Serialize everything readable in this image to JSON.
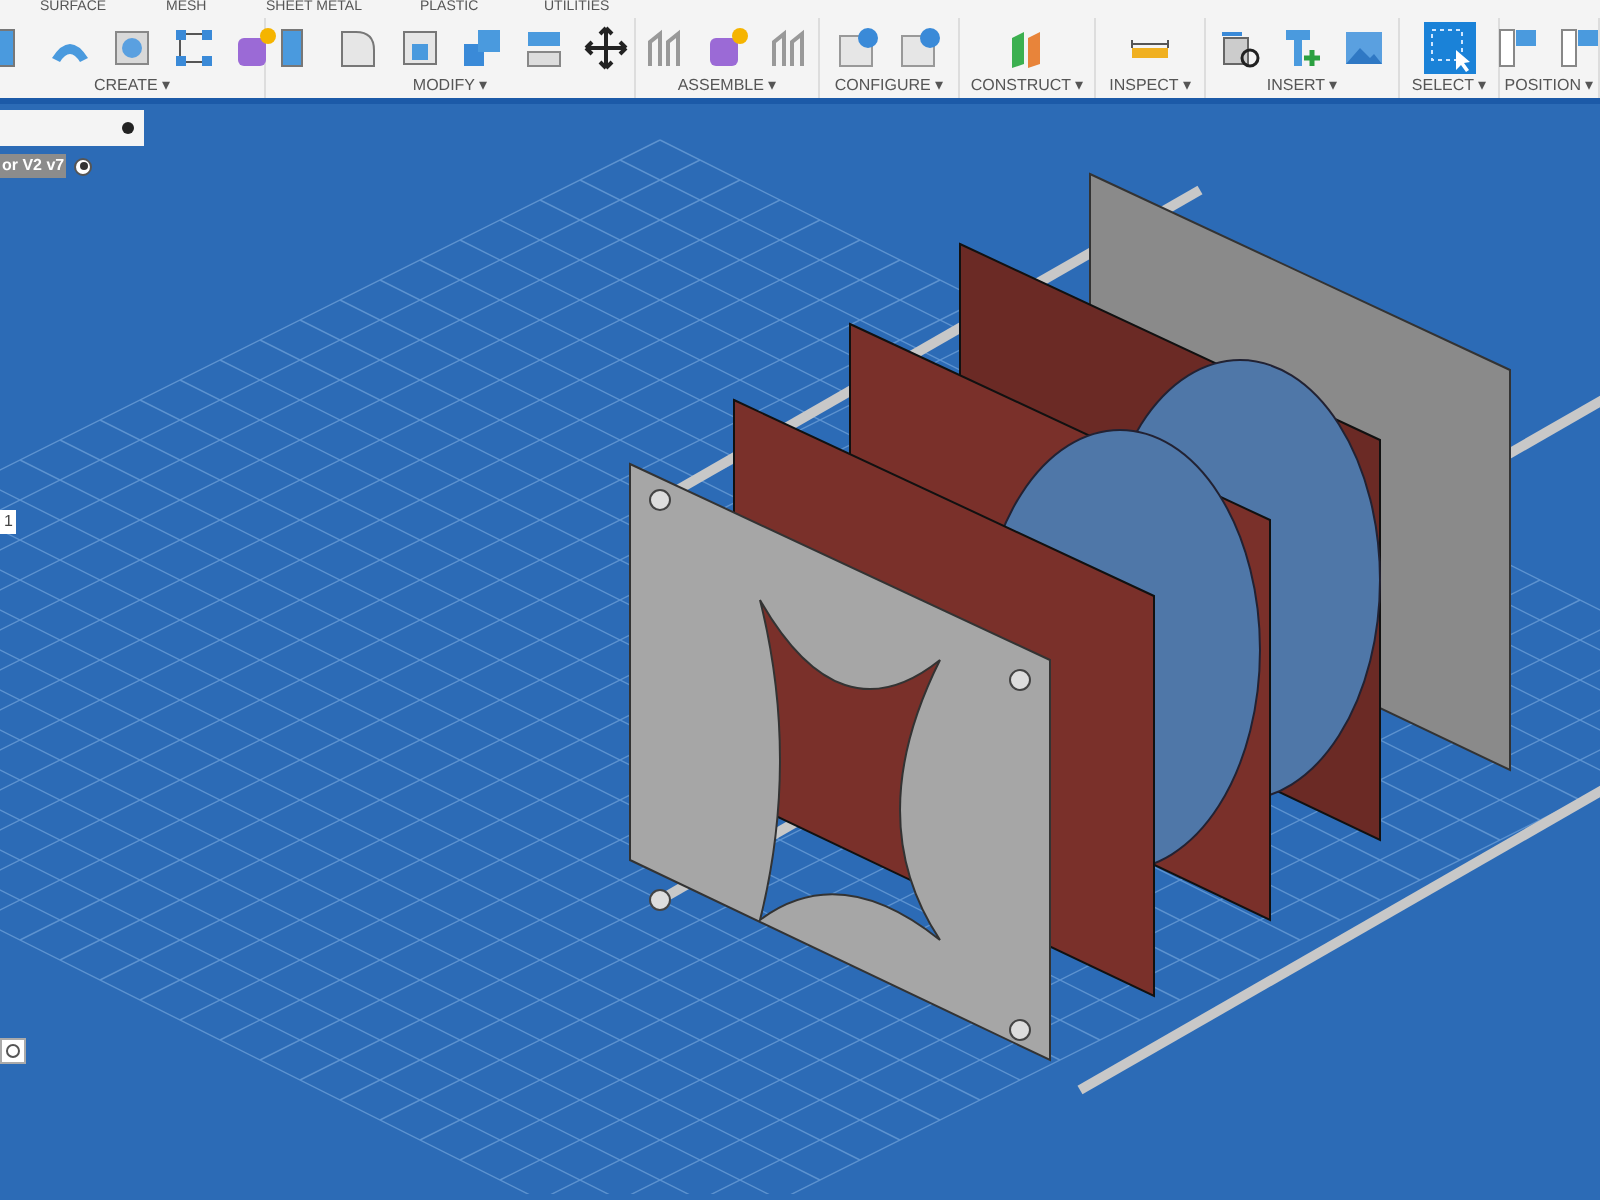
{
  "tabs": [
    {
      "label": "SURFACE"
    },
    {
      "label": "MESH"
    },
    {
      "label": "SHEET METAL"
    },
    {
      "label": "PLASTIC"
    },
    {
      "label": "UTILITIES"
    }
  ],
  "groups": [
    {
      "label": "CREATE ▾"
    },
    {
      "label": "MODIFY ▾"
    },
    {
      "label": "ASSEMBLE ▾"
    },
    {
      "label": "CONFIGURE ▾"
    },
    {
      "label": "CONSTRUCT ▾"
    },
    {
      "label": "INSPECT ▾"
    },
    {
      "label": "INSERT ▾"
    },
    {
      "label": "SELECT ▾"
    },
    {
      "label": "POSITION ▾"
    }
  ],
  "browser": {
    "component_label": "or V2 v7"
  },
  "side_labels": [
    "1"
  ]
}
